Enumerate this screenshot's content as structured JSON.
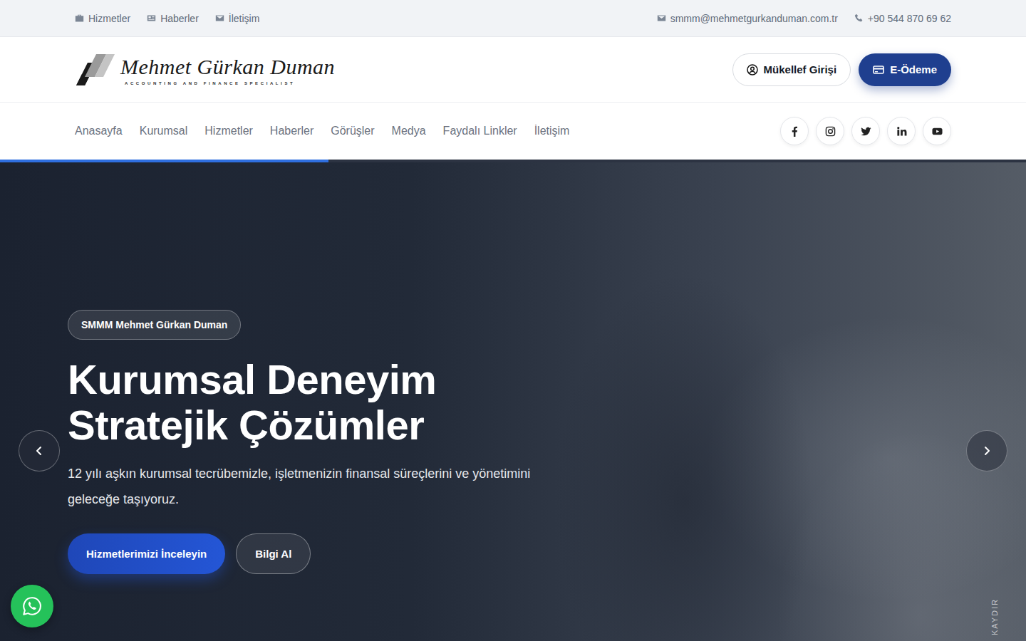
{
  "topbar": {
    "links": [
      {
        "label": "Hizmetler"
      },
      {
        "label": "Haberler"
      },
      {
        "label": "İletişim"
      }
    ],
    "email": "smmm@mehmetgurkanduman.com.tr",
    "phone": "+90 544 870 69 62"
  },
  "logo": {
    "name": "Mehmet Gürkan Duman",
    "tagline": "ACCOUNTING AND FINANCE SPECIALIST"
  },
  "header_buttons": {
    "login": "Mükellef Girişi",
    "payment": "E-Ödeme"
  },
  "nav": {
    "items": [
      "Anasayfa",
      "Kurumsal",
      "Hizmetler",
      "Haberler",
      "Görüşler",
      "Medya",
      "Faydalı Linkler",
      "İletişim"
    ]
  },
  "slider": {
    "progress": {
      "level": 0.32
    },
    "badge": "SMMM Mehmet Gürkan Duman",
    "title_lines": [
      "Kurumsal Deneyim",
      "Stratejik Çözümler"
    ],
    "description": "12 yılı aşkın kurumsal tecrübemizle, işletmenizin finansal süreçlerini ve yönetimini geleceğe taşıyoruz.",
    "buttons": [
      "Hizmetlerimizi İnceleyin",
      "Bilgi Al"
    ],
    "scroll_hint": "KAYDIR"
  }
}
